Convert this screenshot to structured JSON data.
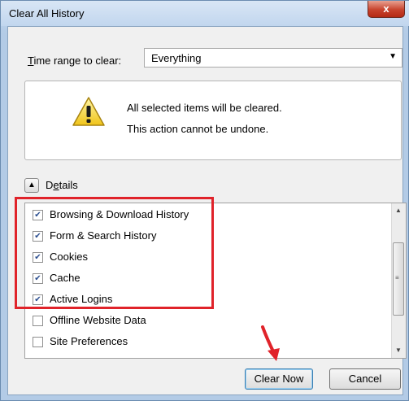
{
  "window": {
    "title": "Clear All History",
    "close_glyph": "x"
  },
  "time_range": {
    "label": "Time range to clear:",
    "selected": "Everything"
  },
  "warning": {
    "icon": "warning-icon",
    "line1": "All selected items will be cleared.",
    "line2": "This action cannot be undone."
  },
  "details": {
    "toggle_glyph": "▲",
    "label": "Details"
  },
  "items": [
    {
      "label": "Browsing & Download History",
      "checked": true
    },
    {
      "label": "Form & Search History",
      "checked": true
    },
    {
      "label": "Cookies",
      "checked": true
    },
    {
      "label": "Cache",
      "checked": true
    },
    {
      "label": "Active Logins",
      "checked": true
    },
    {
      "label": "Offline Website Data",
      "checked": false
    },
    {
      "label": "Site Preferences",
      "checked": false
    }
  ],
  "buttons": {
    "clear_now": "Clear Now",
    "cancel": "Cancel"
  },
  "colors": {
    "highlight": "#e0232a",
    "accent": "#3c7fb1"
  }
}
